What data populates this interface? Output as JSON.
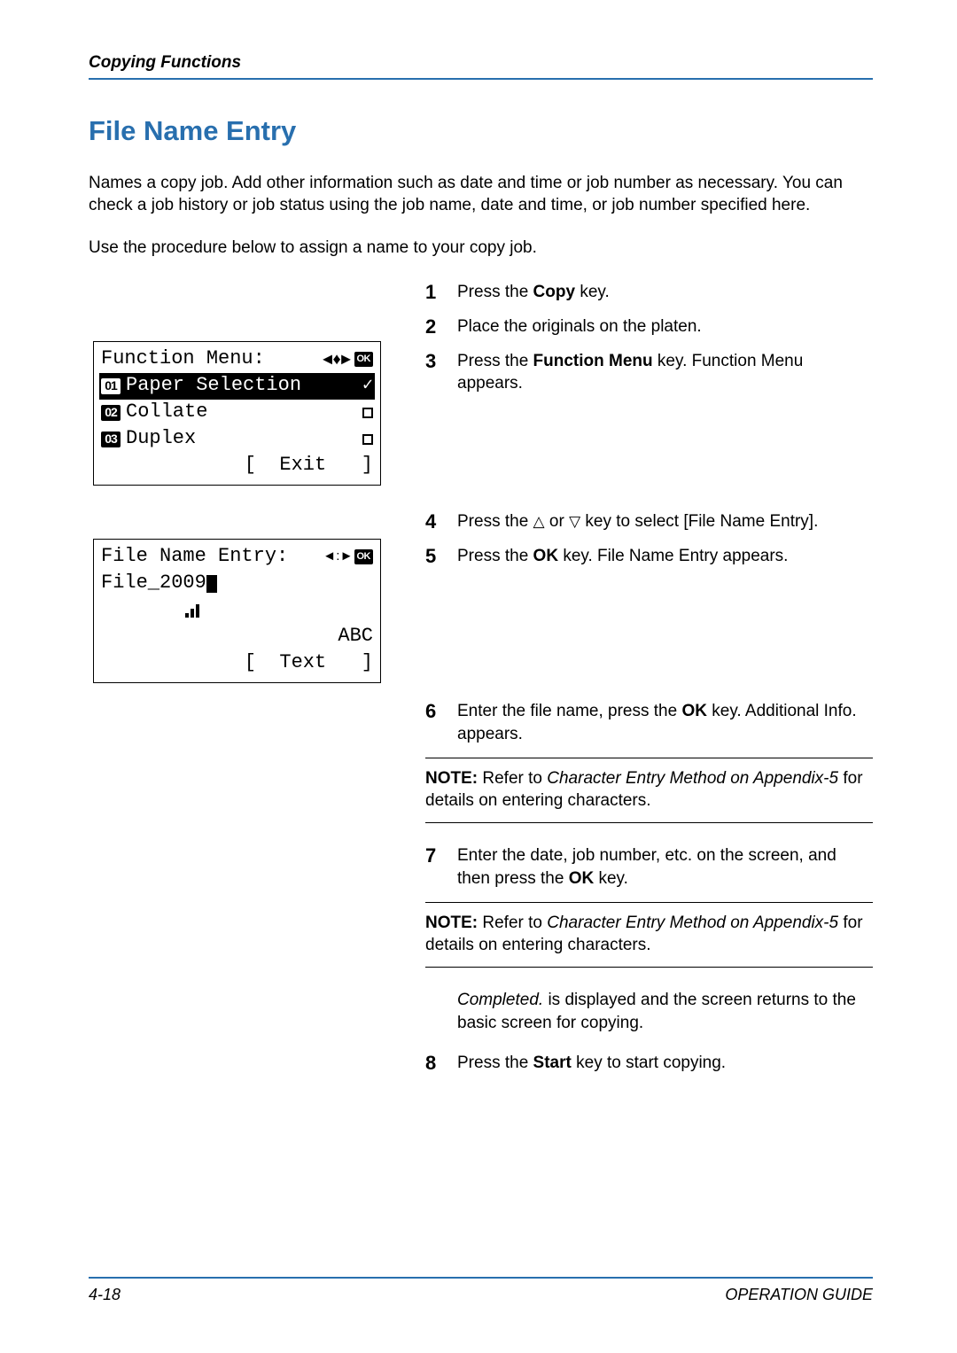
{
  "header": {
    "chapter": "Copying Functions"
  },
  "title": "File Name Entry",
  "intro1": "Names a copy job. Add other information such as date and time or job number as necessary. You can check a job history or job status using the job name, date and time, or job number specified here.",
  "intro2": "Use the procedure below to assign a name to your copy job.",
  "lcd1": {
    "title": "Function Menu:",
    "ok_label": "OK",
    "items": [
      {
        "num": "01",
        "label": "Paper Selection",
        "state": "check"
      },
      {
        "num": "02",
        "label": "Collate",
        "state": "box"
      },
      {
        "num": "03",
        "label": "Duplex",
        "state": "box"
      }
    ],
    "exit": "[  Exit   ]"
  },
  "lcd2": {
    "title": "File Name Entry:",
    "ok_label": "OK",
    "value": "File_2009",
    "mode": " ABC",
    "text": "[  Text   ]"
  },
  "steps": {
    "s1": {
      "num": "1",
      "html": "Press the <b>Copy</b> key."
    },
    "s2": {
      "num": "2",
      "html": "Place the originals on the platen."
    },
    "s3": {
      "num": "3",
      "html": "Press the <b>Function Menu</b> key. Function Menu appears."
    },
    "s4": {
      "num": "4",
      "html": "Press the <span class='tri'>△</span> or <span class='tri'>▽</span> key to select [File Name Entry]."
    },
    "s5": {
      "num": "5",
      "html": "Press the <b>OK</b> key. File Name Entry appears."
    },
    "s6": {
      "num": "6",
      "html": "Enter the file name, press the <b>OK</b> key. Additional Info. appears."
    },
    "s7": {
      "num": "7",
      "html": "Enter the date, job number, etc. on the screen, and then press the <b>OK</b> key."
    },
    "s8": {
      "num": "8",
      "html": "Press the <b>Start</b> key to start copying."
    }
  },
  "note1": "<b>NOTE:</b> Refer to <i>Character Entry Method on Appendix-5</i> for details on entering characters.",
  "note2": "<b>NOTE:</b> Refer to <i>Character Entry Method on Appendix-5</i> for details on entering characters.",
  "completed": "<i>Completed.</i> is displayed and the screen returns to the basic screen for copying.",
  "footer": {
    "page": "4-18",
    "book": "OPERATION GUIDE"
  }
}
